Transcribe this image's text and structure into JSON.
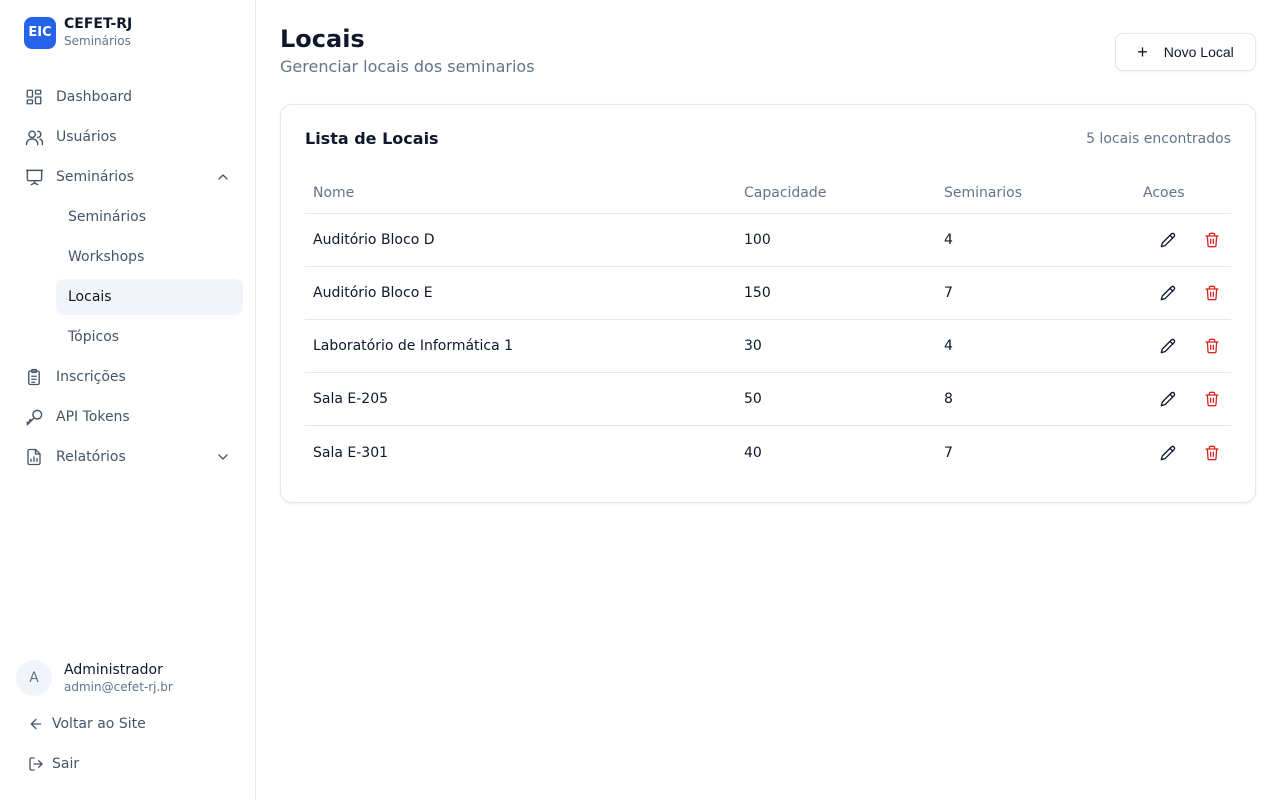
{
  "brand": {
    "logo": "EIC",
    "title": "CEFET-RJ",
    "subtitle": "Seminários"
  },
  "nav": {
    "dashboard": "Dashboard",
    "usuarios": "Usuários",
    "seminarios": "Seminários",
    "sub": {
      "seminarios": "Seminários",
      "workshops": "Workshops",
      "locais": "Locais",
      "topicos": "Tópicos"
    },
    "inscricoes": "Inscrições",
    "api_tokens": "API Tokens",
    "relatorios": "Relatórios"
  },
  "user": {
    "initial": "A",
    "name": "Administrador",
    "email": "admin@cefet-rj.br"
  },
  "footer": {
    "back": "Voltar ao Site",
    "logout": "Sair"
  },
  "page": {
    "title": "Locais",
    "subtitle": "Gerenciar locais dos seminarios",
    "new_button": "Novo Local",
    "new_icon": "+"
  },
  "card": {
    "title": "Lista de Locais",
    "count": "5 locais encontrados",
    "columns": {
      "name": "Nome",
      "capacity": "Capacidade",
      "seminars": "Seminarios",
      "actions": "Acoes"
    },
    "rows": [
      {
        "name": "Auditório Bloco D",
        "capacity": "100",
        "seminars": "4"
      },
      {
        "name": "Auditório Bloco E",
        "capacity": "150",
        "seminars": "7"
      },
      {
        "name": "Laboratório de Informática 1",
        "capacity": "30",
        "seminars": "4"
      },
      {
        "name": "Sala E-205",
        "capacity": "50",
        "seminars": "8"
      },
      {
        "name": "Sala E-301",
        "capacity": "40",
        "seminars": "7"
      }
    ]
  },
  "colors": {
    "brand": "#2563eb",
    "delete": "#dc2626",
    "muted": "#64748b",
    "active_bg": "#f1f5f9"
  },
  "icons": [
    "dashboard-icon",
    "users-icon",
    "presentation-icon",
    "chevron-up-icon",
    "clipboard-icon",
    "key-icon",
    "report-icon",
    "chevron-down-icon",
    "arrow-left-icon",
    "logout-icon",
    "plus-icon",
    "pencil-icon",
    "trash-icon"
  ]
}
